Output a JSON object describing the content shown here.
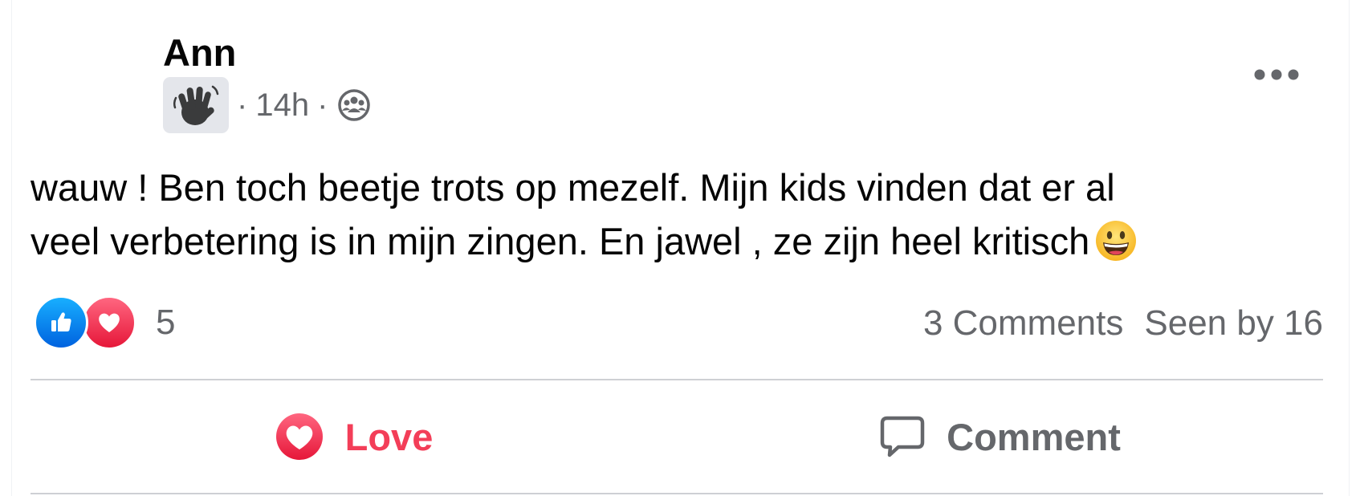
{
  "post": {
    "author": "Ann",
    "badge_icon": "waving-hand-icon",
    "time": "14h",
    "separator": "·",
    "audience_icon": "group-audience-icon",
    "text_line1": "wauw ! Ben toch beetje trots op mezelf. Mijn kids vinden dat er al",
    "text_line2": "veel verbetering is in mijn zingen. En jawel , ze zijn heel kritisch",
    "emoji": "grinning-face-emoji"
  },
  "stats": {
    "reactions": [
      "like",
      "love"
    ],
    "reaction_count": "5",
    "comments": "3 Comments",
    "seen_by": "Seen by 16"
  },
  "actions": {
    "love_label": "Love",
    "comment_label": "Comment"
  },
  "colors": {
    "love": "#f33e58",
    "like_blue": "#0866ff",
    "secondary_text": "#65676b",
    "divider": "#ced0d4"
  }
}
